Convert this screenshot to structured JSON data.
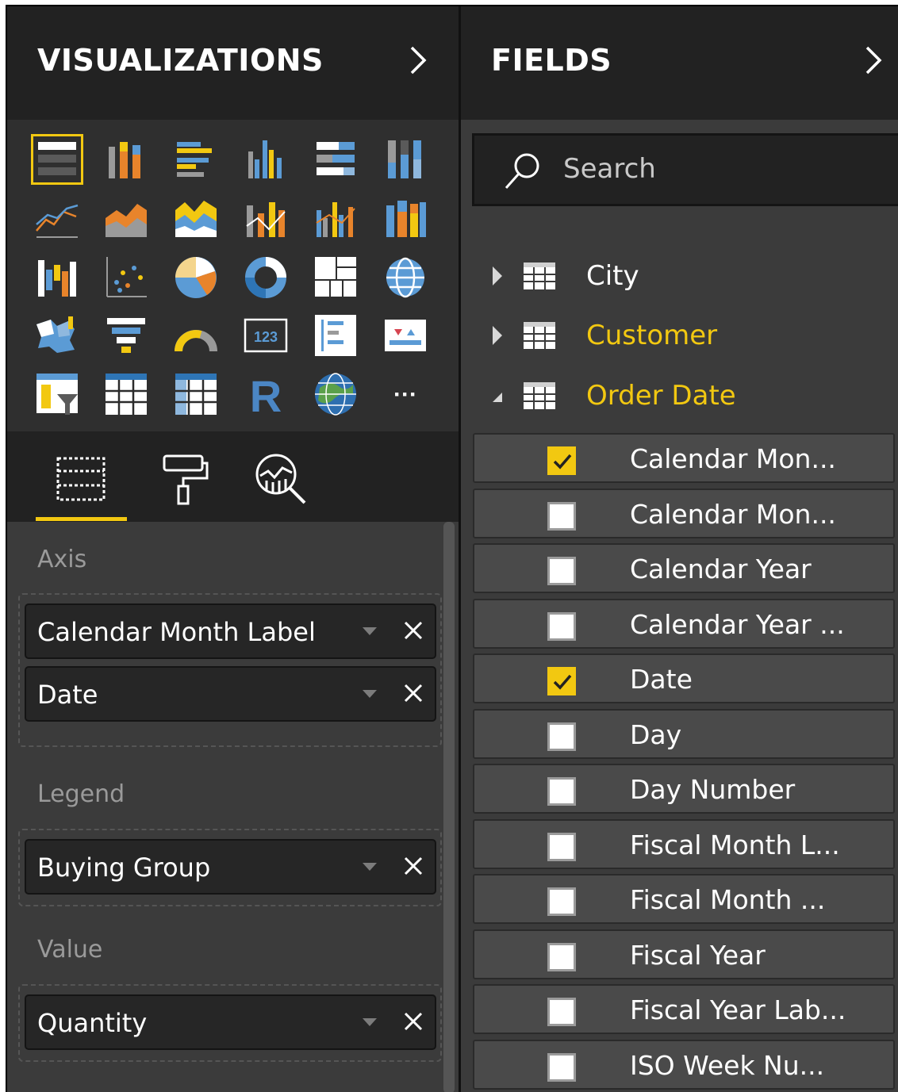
{
  "colors": {
    "accent": "#f2c811",
    "pane_dark": "#222222",
    "pane_mid": "#3b3b3b",
    "text": "#ffffff",
    "muted": "#9a9a9a"
  },
  "visualizations": {
    "title": "VISUALIZATIONS",
    "collapse_icon": "chevron-right-icon",
    "gallery": [
      "stacked-bar-chart-icon",
      "stacked-column-chart-icon",
      "clustered-bar-chart-icon",
      "clustered-column-chart-icon",
      "100-stacked-bar-chart-icon",
      "100-stacked-column-chart-icon",
      "line-chart-icon",
      "area-chart-icon",
      "stacked-area-chart-icon",
      "line-and-stacked-column-chart-icon",
      "line-and-clustered-column-chart-icon",
      "ribbon-chart-icon",
      "waterfall-chart-icon",
      "scatter-chart-icon",
      "pie-chart-icon",
      "donut-chart-icon",
      "treemap-icon",
      "map-icon",
      "filled-map-icon",
      "funnel-icon",
      "gauge-icon",
      "card-icon",
      "multi-row-card-icon",
      "kpi-icon",
      "slicer-icon",
      "table-icon",
      "matrix-icon",
      "r-script-visual-icon",
      "arcgis-map-icon",
      "more-visuals-icon"
    ],
    "selected_index": 0,
    "card_text": "123",
    "r_label": "R",
    "more_label": "···",
    "tabs": [
      "fields-tab-icon",
      "format-tab-icon",
      "analytics-tab-icon"
    ],
    "wells": [
      {
        "label": "Axis",
        "items": [
          "Calendar Month Label",
          "Date"
        ]
      },
      {
        "label": "Legend",
        "items": [
          "Buying Group"
        ]
      },
      {
        "label": "Value",
        "items": [
          "Quantity"
        ]
      }
    ],
    "remove_icon": "close-icon",
    "dropdown_icon": "dropdown-arrow-icon"
  },
  "fields": {
    "title": "FIELDS",
    "collapse_icon": "chevron-right-icon",
    "search_placeholder": "Search",
    "tables": [
      {
        "name": "City",
        "expanded": false,
        "color": "#ffffff"
      },
      {
        "name": "Customer",
        "expanded": false,
        "color": "#f2c811"
      },
      {
        "name": "Order Date",
        "expanded": true,
        "color": "#f2c811"
      }
    ],
    "order_date_fields": [
      {
        "name": "Calendar Mon...",
        "checked": true
      },
      {
        "name": "Calendar Mon...",
        "checked": false
      },
      {
        "name": "Calendar Year",
        "checked": false
      },
      {
        "name": "Calendar Year ...",
        "checked": false
      },
      {
        "name": "Date",
        "checked": true
      },
      {
        "name": "Day",
        "checked": false
      },
      {
        "name": "Day Number",
        "checked": false
      },
      {
        "name": "Fiscal Month L...",
        "checked": false
      },
      {
        "name": "Fiscal Month ...",
        "checked": false
      },
      {
        "name": "Fiscal Year",
        "checked": false
      },
      {
        "name": "Fiscal Year Lab...",
        "checked": false
      },
      {
        "name": "ISO Week Nu...",
        "checked": false
      }
    ]
  }
}
